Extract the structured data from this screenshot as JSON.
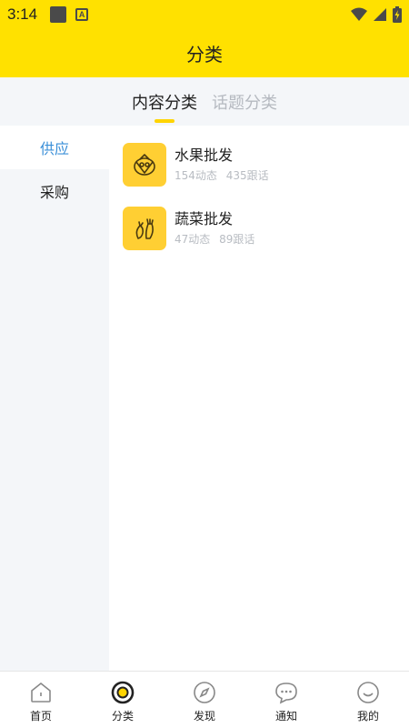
{
  "status": {
    "time": "3:14",
    "app_badge": "A"
  },
  "header": {
    "title": "分类"
  },
  "tabs": [
    {
      "label": "内容分类",
      "active": true
    },
    {
      "label": "话题分类",
      "active": false
    }
  ],
  "sidebar": {
    "items": [
      {
        "label": "供应",
        "active": true
      },
      {
        "label": "采购",
        "active": false
      }
    ]
  },
  "categories": [
    {
      "title": "水果批发",
      "posts": "154动态",
      "replies": "435跟话",
      "icon": "fruit-basket-icon"
    },
    {
      "title": "蔬菜批发",
      "posts": "47动态",
      "replies": "89跟话",
      "icon": "vegetables-icon"
    }
  ],
  "bottom_nav": [
    {
      "label": "首页",
      "icon": "home-icon",
      "active": false
    },
    {
      "label": "分类",
      "icon": "category-target-icon",
      "active": true
    },
    {
      "label": "发现",
      "icon": "compass-icon",
      "active": false
    },
    {
      "label": "通知",
      "icon": "chat-bubble-icon",
      "active": false
    },
    {
      "label": "我的",
      "icon": "smiley-icon",
      "active": false
    }
  ],
  "colors": {
    "brand_yellow": "#ffe100",
    "icon_yellow": "#ffcf33",
    "active_blue": "#3a8fd8",
    "panel_gray": "#f4f6f9"
  }
}
